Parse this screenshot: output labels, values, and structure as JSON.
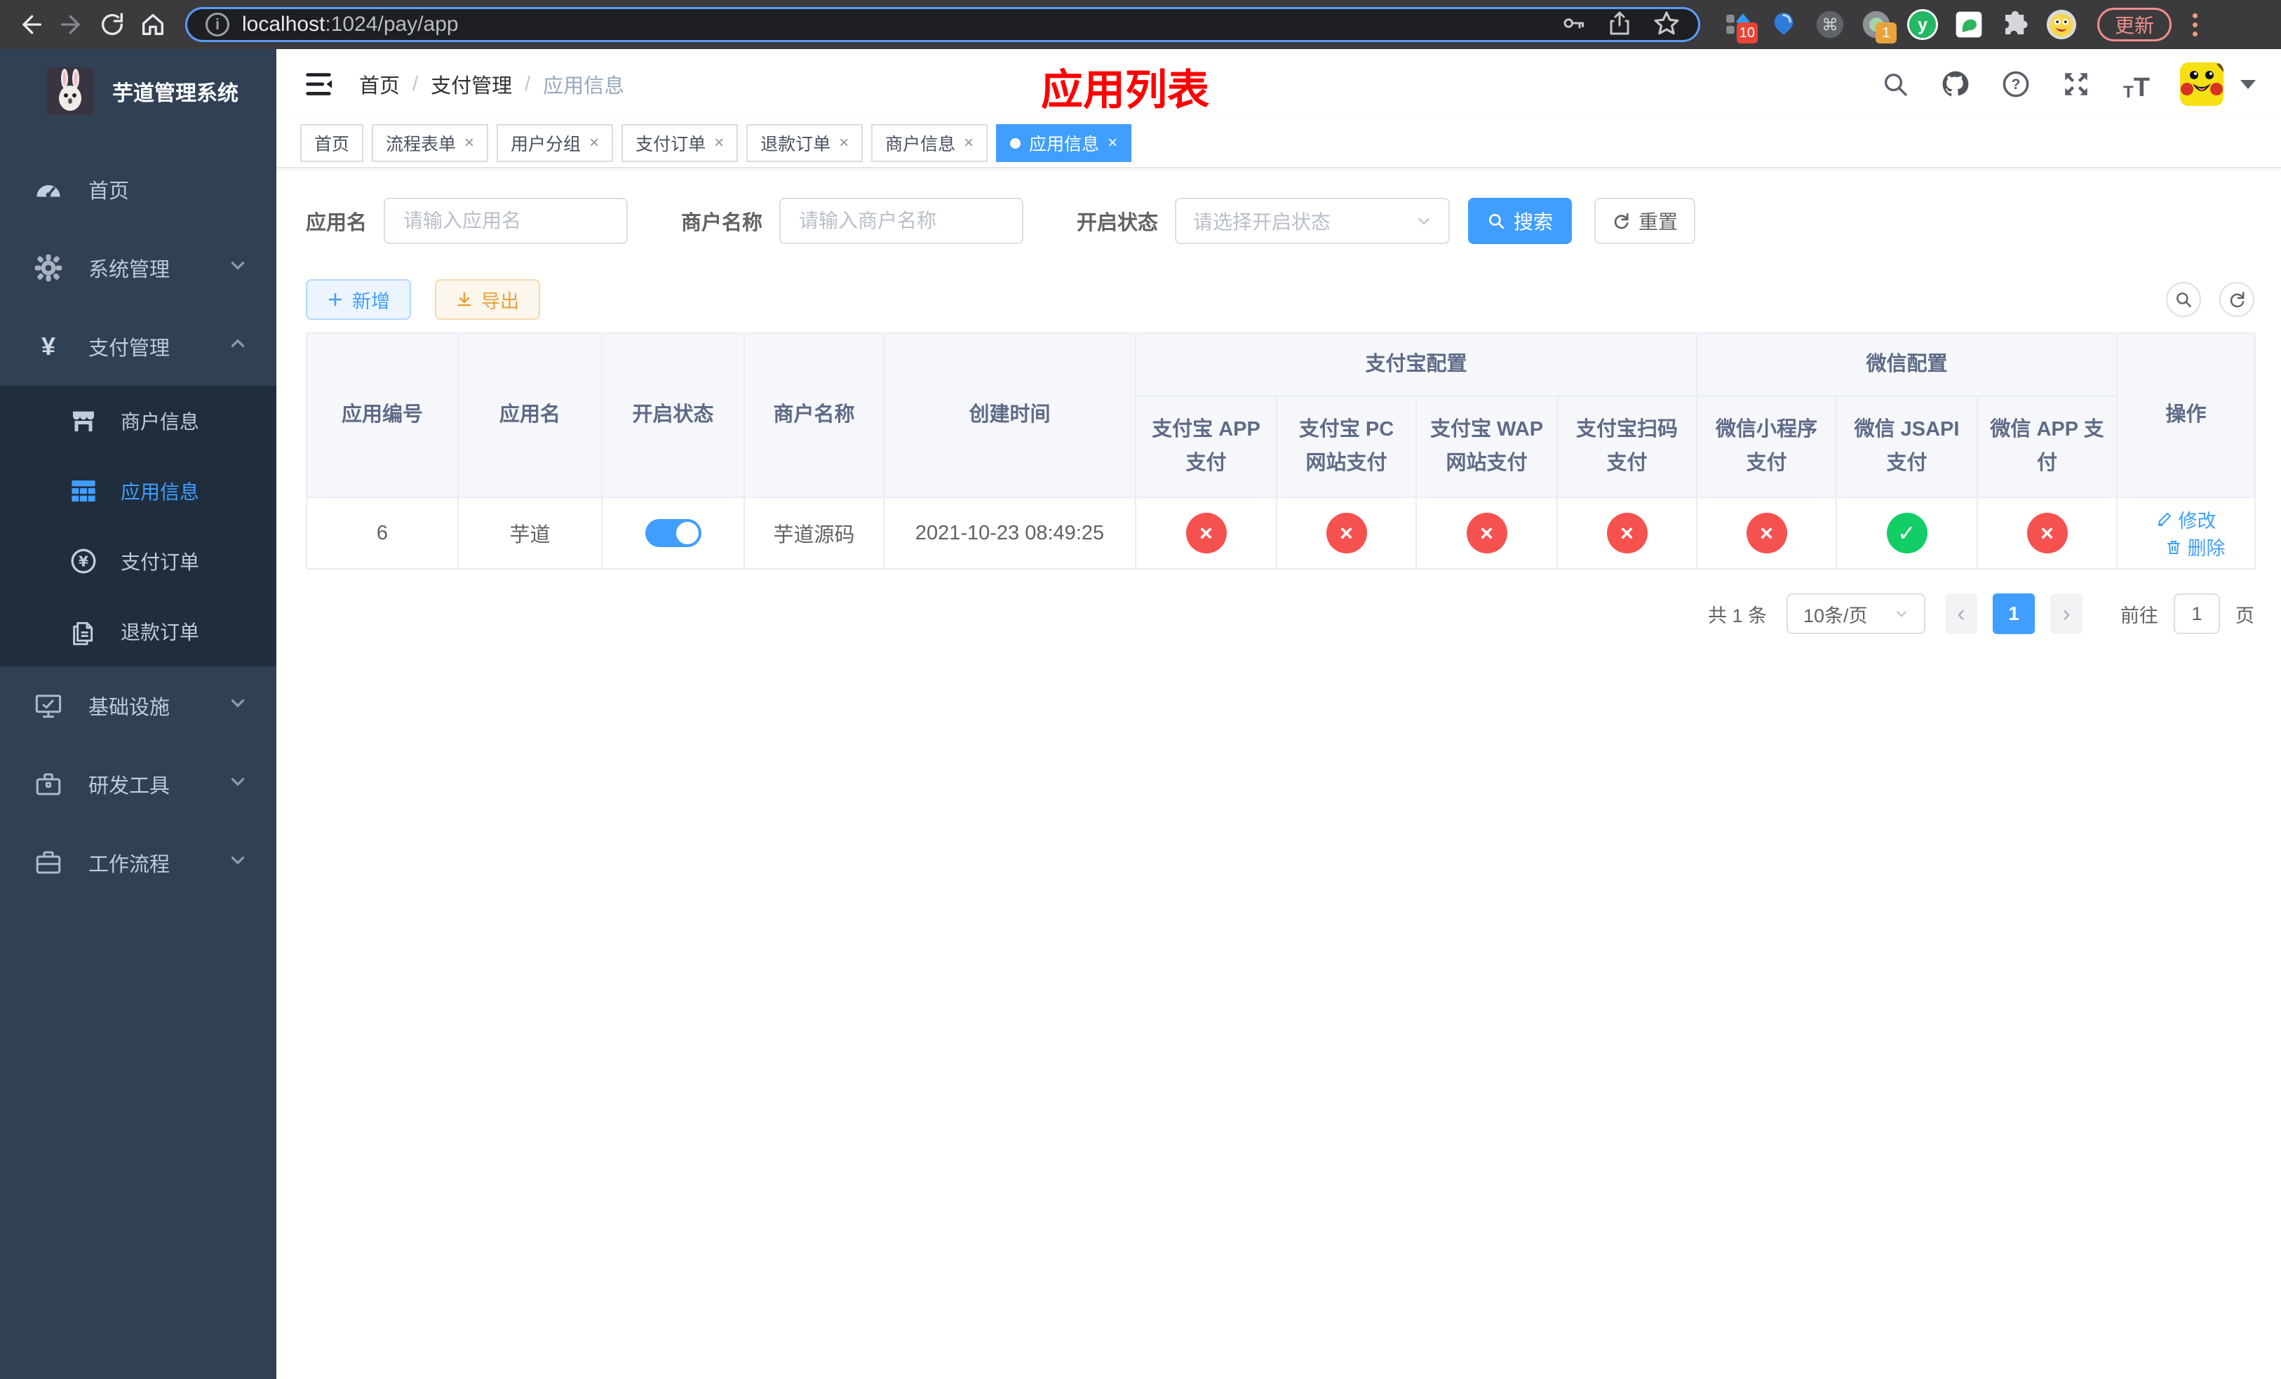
{
  "browser": {
    "url_host": "localhost",
    "url_path": ":1024/pay/app",
    "update_label": "更新",
    "ext_badge_10": "10",
    "ext_badge_1": "1",
    "accent_blue": "#5b9bf8"
  },
  "sidebar": {
    "logo_title": "芋道管理系统",
    "menu": [
      {
        "label": "首页"
      },
      {
        "label": "系统管理"
      },
      {
        "label": "支付管理"
      },
      {
        "label": "基础设施"
      },
      {
        "label": "研发工具"
      },
      {
        "label": "工作流程"
      }
    ],
    "submenu": [
      {
        "label": "商户信息"
      },
      {
        "label": "应用信息"
      },
      {
        "label": "支付订单"
      },
      {
        "label": "退款订单"
      }
    ]
  },
  "navbar": {
    "breadcrumb": [
      "首页",
      "支付管理",
      "应用信息"
    ],
    "overlay_title": "应用列表"
  },
  "tags": [
    {
      "label": "首页"
    },
    {
      "label": "流程表单"
    },
    {
      "label": "用户分组"
    },
    {
      "label": "支付订单"
    },
    {
      "label": "退款订单"
    },
    {
      "label": "商户信息"
    },
    {
      "label": "应用信息"
    }
  ],
  "filters": {
    "app_name_label": "应用名",
    "app_name_placeholder": "请输入应用名",
    "merchant_label": "商户名称",
    "merchant_placeholder": "请输入商户名称",
    "status_label": "开启状态",
    "status_placeholder": "请选择开启状态",
    "search_label": "搜索",
    "reset_label": "重置"
  },
  "toolbar": {
    "add_label": "新增",
    "export_label": "导出"
  },
  "table": {
    "group_alipay": "支付宝配置",
    "group_wechat": "微信配置",
    "col_app_id": "应用编号",
    "col_app_name": "应用名",
    "col_status": "开启状态",
    "col_merchant": "商户名称",
    "col_created": "创建时间",
    "alipay_cols": [
      "支付宝 APP 支付",
      "支付宝 PC 网站支付",
      "支付宝 WAP 网站支付",
      "支付宝扫码支付"
    ],
    "wechat_cols": [
      "微信小程序支付",
      "微信 JSAPI 支付",
      "微信 APP 支付"
    ],
    "col_ops": "操作",
    "row": {
      "app_id": "6",
      "app_name": "芋道",
      "enabled": true,
      "merchant": "芋道源码",
      "created_at": "2021-10-23 08:49:25",
      "pay_channels": [
        false,
        false,
        false,
        false,
        false,
        true,
        false
      ],
      "edit_label": "修改",
      "delete_label": "删除"
    },
    "status_colors": {
      "off": "#f5524f",
      "on": "#13ce66"
    }
  },
  "pagination": {
    "total": "共 1 条",
    "page_size": "10条/页",
    "current_page": "1",
    "goto_label": "前往",
    "goto_value": "1",
    "page_unit": "页"
  }
}
